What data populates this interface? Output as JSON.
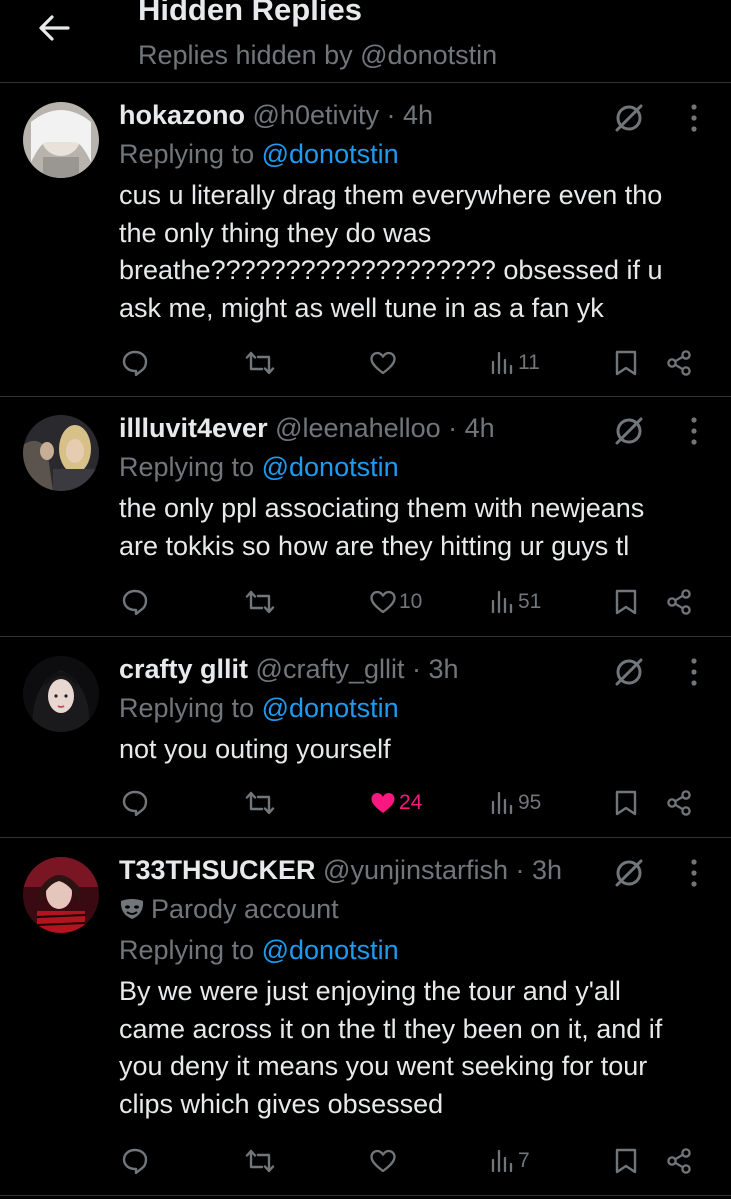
{
  "header": {
    "title": "Hidden Replies",
    "subtitle": "Replies hidden by @donotstin"
  },
  "colors": {
    "accent": "#1d9bf0",
    "like": "#f91880",
    "muted": "#71767b"
  },
  "tweets": [
    {
      "name": "hokazono",
      "handle": "@h0etivity",
      "time": "· 4h",
      "replying_prefix": "Replying to",
      "replying_to": "@donotstin",
      "lines": [
        "cus u literally drag them everywhere even tho",
        "the only thing they do was",
        "breathe??????????????????? obsessed if u",
        "ask me, might as well tune in as a fan yk"
      ],
      "likes": "",
      "views": "11"
    },
    {
      "name": "illluvit4ever",
      "handle": "@leenahelloo",
      "time": "· 4h",
      "replying_prefix": "Replying to",
      "replying_to": "@donotstin",
      "lines": [
        "the only ppl associating them with newjeans",
        "are tokkis so how are they hitting ur guys tl"
      ],
      "likes": "10",
      "views": "51"
    },
    {
      "name": "crafty gllit",
      "handle": "@crafty_gllit",
      "time": "· 3h",
      "replying_prefix": "Replying to",
      "replying_to": "@donotstin",
      "lines": [
        "not you outing yourself"
      ],
      "likes": "24",
      "liked": true,
      "views": "95"
    },
    {
      "name": "T33THSUCKER",
      "handle": "@yunjinstarfish",
      "time": "· 3h",
      "parody_label": "Parody account",
      "replying_prefix": "Replying to",
      "replying_to": "@donotstin",
      "lines": [
        "By we were just enjoying the tour and y'all",
        "came across it on the tl they been on it, and if",
        "you deny it means you went seeking for tour",
        "clips which gives obsessed"
      ],
      "likes": "",
      "views": "7"
    }
  ]
}
